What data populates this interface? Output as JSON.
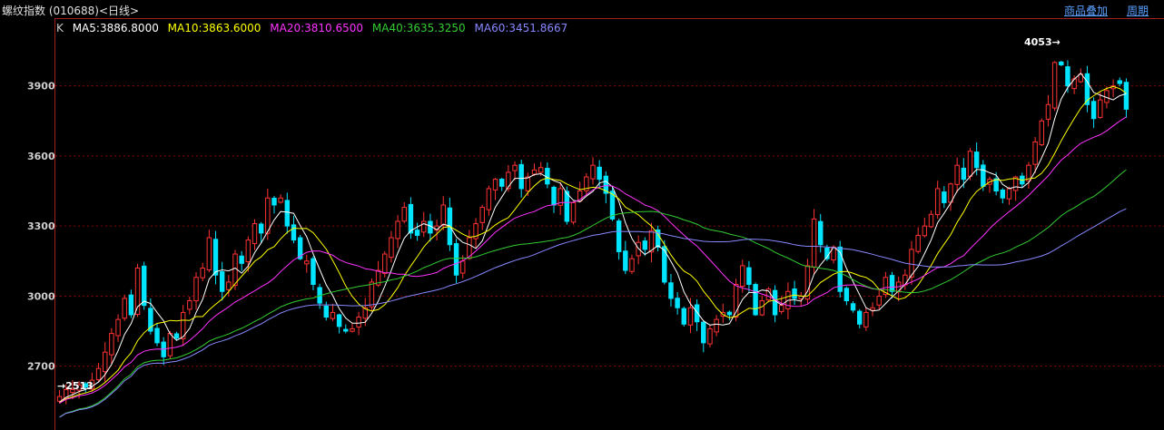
{
  "header": {
    "title": "螺纹指数 (010688)<日线>",
    "overlay_link": "商品叠加",
    "period_link": "周期"
  },
  "legend": [
    {
      "label": "K",
      "color": "#cccccc"
    },
    {
      "label": "MA5:3886.8000",
      "color": "#ffffff"
    },
    {
      "label": "MA10:3863.6000",
      "color": "#ffff00"
    },
    {
      "label": "MA20:3810.6500",
      "color": "#ff33ff"
    },
    {
      "label": "MA40:3635.3250",
      "color": "#33cc33"
    },
    {
      "label": "MA60:3451.8667",
      "color": "#8888ff"
    }
  ],
  "chart_data": {
    "type": "candlestick",
    "title": "螺纹指数 (010688)<日线>",
    "ylim": [
      2450,
      4120
    ],
    "yticks": [
      2700,
      3000,
      3300,
      3600,
      3900
    ],
    "grid": true,
    "high_label": "4053",
    "low_label": "2513",
    "colors": {
      "up": "#ff3333",
      "down": "#00e5ff",
      "ma5": "#ffffff",
      "ma10": "#ffff00",
      "ma20": "#ff33ff",
      "ma40": "#33cc33",
      "ma60": "#8888ff",
      "grid": "#8b0000"
    },
    "close": [
      2570,
      2600,
      2600,
      2620,
      2610,
      2640,
      2690,
      2760,
      2840,
      2900,
      2990,
      2920,
      3120,
      2960,
      2850,
      2800,
      2740,
      2840,
      2820,
      2930,
      2980,
      3080,
      3120,
      3250,
      3090,
      3020,
      3060,
      3180,
      3140,
      3240,
      3310,
      3270,
      3420,
      3390,
      3420,
      3300,
      3240,
      3160,
      3150,
      3050,
      2970,
      2910,
      2930,
      2870,
      2850,
      2860,
      2910,
      2950,
      3060,
      3110,
      3180,
      3250,
      3320,
      3380,
      3270,
      3260,
      3320,
      3270,
      3300,
      3390,
      3220,
      3090,
      3150,
      3250,
      3310,
      3380,
      3460,
      3500,
      3470,
      3530,
      3560,
      3460,
      3510,
      3540,
      3550,
      3480,
      3390,
      3460,
      3320,
      3400,
      3450,
      3510,
      3560,
      3500,
      3440,
      3330,
      3190,
      3110,
      3160,
      3230,
      3200,
      3280,
      3210,
      3060,
      2990,
      2950,
      2880,
      2950,
      2890,
      2800,
      2860,
      2900,
      2930,
      2920,
      3050,
      3130,
      3050,
      2920,
      2980,
      3030,
      2920,
      2960,
      3020,
      2990,
      3000,
      3130,
      3330,
      3220,
      3160,
      3210,
      3020,
      2980,
      2940,
      2880,
      2930,
      2950,
      3000,
      3080,
      3020,
      3060,
      3090,
      3200,
      3260,
      3300,
      3350,
      3460,
      3400,
      3480,
      3560,
      3500,
      3620,
      3550,
      3470,
      3500,
      3450,
      3420,
      3460,
      3510,
      3480,
      3560,
      3660,
      3750,
      3820,
      4000,
      3990,
      3900,
      3930,
      3950,
      3820,
      3760,
      3840,
      3880,
      3900,
      3910,
      3800
    ]
  }
}
